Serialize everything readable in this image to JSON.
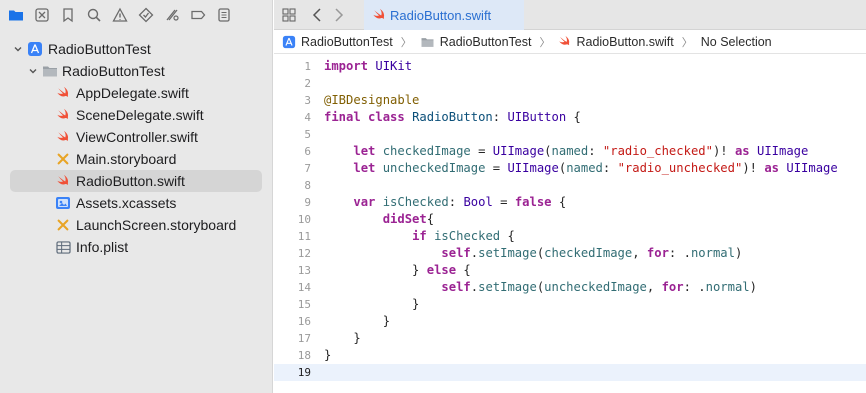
{
  "window": {
    "accent": "#2a6fd1"
  },
  "navigator": {
    "toolbar_icons": [
      "folder-icon",
      "source-control-icon",
      "bookmark-icon",
      "find-icon",
      "issue-icon",
      "test-icon",
      "debug-icon",
      "breakpoint-icon",
      "report-icon"
    ],
    "tree": [
      {
        "label": "RadioButtonTest",
        "icon": "project-icon",
        "level": 0,
        "expanded": true
      },
      {
        "label": "RadioButtonTest",
        "icon": "folder-icon",
        "level": 1,
        "expanded": true
      },
      {
        "label": "AppDelegate.swift",
        "icon": "swift-icon",
        "level": 2
      },
      {
        "label": "SceneDelegate.swift",
        "icon": "swift-icon",
        "level": 2
      },
      {
        "label": "ViewController.swift",
        "icon": "swift-icon",
        "level": 2
      },
      {
        "label": "Main.storyboard",
        "icon": "storyboard-icon",
        "level": 2
      },
      {
        "label": "RadioButton.swift",
        "icon": "swift-icon",
        "level": 2,
        "selected": true
      },
      {
        "label": "Assets.xcassets",
        "icon": "assets-icon",
        "level": 2
      },
      {
        "label": "LaunchScreen.storyboard",
        "icon": "storyboard-icon",
        "level": 2
      },
      {
        "label": "Info.plist",
        "icon": "plist-icon",
        "level": 2
      }
    ]
  },
  "editor": {
    "active_tab": "RadioButton.swift",
    "jumpbar": {
      "project": "RadioButtonTest",
      "group": "RadioButtonTest",
      "file": "RadioButton.swift",
      "symbol": "No Selection"
    },
    "current_line": 19,
    "lines": [
      {
        "n": "1",
        "code": "import UIKit"
      },
      {
        "n": "2",
        "code": ""
      },
      {
        "n": "3",
        "code": "@IBDesignable"
      },
      {
        "n": "4",
        "code": "final class RadioButton: UIButton {"
      },
      {
        "n": "5",
        "code": ""
      },
      {
        "n": "6",
        "code": "    let checkedImage = UIImage(named: \"radio_checked\")! as UIImage"
      },
      {
        "n": "7",
        "code": "    let uncheckedImage = UIImage(named: \"radio_unchecked\")! as UIImage"
      },
      {
        "n": "8",
        "code": ""
      },
      {
        "n": "9",
        "code": "    var isChecked: Bool = false {"
      },
      {
        "n": "10",
        "code": "        didSet{"
      },
      {
        "n": "11",
        "code": "            if isChecked {"
      },
      {
        "n": "12",
        "code": "                self.setImage(checkedImage, for: .normal)"
      },
      {
        "n": "13",
        "code": "            } else {"
      },
      {
        "n": "14",
        "code": "                self.setImage(uncheckedImage, for: .normal)"
      },
      {
        "n": "15",
        "code": "            }"
      },
      {
        "n": "16",
        "code": "        }"
      },
      {
        "n": "17",
        "code": "    }"
      },
      {
        "n": "18",
        "code": "}"
      },
      {
        "n": "19",
        "code": ""
      }
    ]
  }
}
